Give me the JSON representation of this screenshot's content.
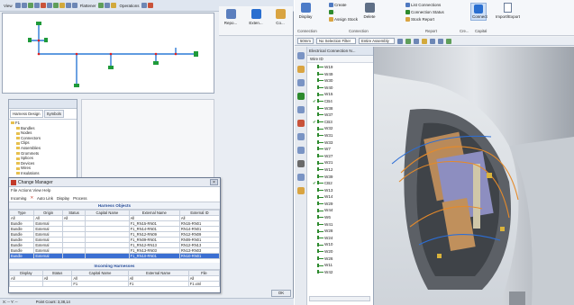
{
  "left_toolbar": {
    "view_label": "View",
    "flattener_label": "Flattener",
    "operations_label": "Operations"
  },
  "left_ribbon": {
    "items": [
      "Repo...",
      "Exten...",
      "Co..."
    ]
  },
  "design_window": {
    "tabs": [
      "Harness Design",
      "Symbols"
    ],
    "root": "F1",
    "tree_items": [
      "Bundles",
      "Nodes",
      "Connectors",
      "Clips",
      "Assemblies",
      "Grommets",
      "Splices",
      "Devices",
      "Wires",
      "Insulations"
    ]
  },
  "change_manager": {
    "title": "Change Manager",
    "menu": "File  Actions  View  Help",
    "toolbar": [
      "Incoming",
      "Auto Link",
      "Display",
      "Process"
    ],
    "harness_section": "Harness Objects",
    "harness_columns": [
      "Type",
      "Origin",
      "Status",
      "Capital Name",
      "External Name",
      "External ID"
    ],
    "harness_filter": [
      "All",
      "All",
      "All",
      "",
      "All",
      "All"
    ],
    "harness_rows": [
      [
        "Bundle",
        "External",
        "",
        "",
        "F1_RN15-RN01",
        "RN15-RN01"
      ],
      [
        "Bundle",
        "External",
        "",
        "",
        "F1_RN14-RN01",
        "RN14-RN01"
      ],
      [
        "Bundle",
        "External",
        "",
        "",
        "F1_RN12-RN09",
        "RN12-RN09"
      ],
      [
        "Bundle",
        "External",
        "",
        "",
        "F1_RN09-RN01",
        "RN09-RN01"
      ],
      [
        "Bundle",
        "External",
        "",
        "",
        "F1_RN12-RN13",
        "RN12-RN13"
      ],
      [
        "Bundle",
        "External",
        "",
        "",
        "F1_RN13-RN03",
        "RN13-RN03"
      ],
      [
        "Bundle",
        "External",
        "",
        "",
        "F1_RN10-RN01",
        "RN10-RN01"
      ]
    ],
    "selected_row": 6,
    "incoming_section": "Incoming Harnesses",
    "incoming_columns": [
      "Display",
      "Status",
      "Capital Name",
      "External Name",
      "File"
    ],
    "incoming_filter": [
      "All",
      "All",
      "All",
      "All",
      "All"
    ],
    "incoming_rows": [
      [
        "",
        "",
        "F1",
        "F1",
        "F1.xml"
      ]
    ],
    "ok_label": "OK"
  },
  "status_left": {
    "coords": "X: -- Y: --",
    "msg": "Point Count: 3,38,14"
  },
  "ribbon": {
    "display_label": "Display",
    "create_label": "Create",
    "delete_label": "Delete",
    "assign_stock_label": "Assign Stock",
    "list_connections_label": "List Connections",
    "connection_status_label": "Connection Status",
    "stock_report_label": "Stock Report",
    "connect_label": "Connect",
    "import_export_label": "Import/Export",
    "groups": [
      "Connection",
      "Connection",
      "Report",
      "Cre...",
      "Capital"
    ]
  },
  "option_bar": {
    "unit": "50mm",
    "filter": "No Selection Filter",
    "assembly": "Entire Assembly"
  },
  "ecob": {
    "title": "Electrical Connection N...",
    "column": "Wire ID",
    "wires": [
      {
        "id": "W19",
        "check": false
      },
      {
        "id": "W49",
        "check": false
      },
      {
        "id": "W30",
        "check": false
      },
      {
        "id": "W40",
        "check": false
      },
      {
        "id": "W15",
        "check": false
      },
      {
        "id": "CB4",
        "check": true,
        "group": true
      },
      {
        "id": "W38",
        "check": false
      },
      {
        "id": "W37",
        "check": false
      },
      {
        "id": "CB3",
        "check": true,
        "group": true
      },
      {
        "id": "W32",
        "check": false
      },
      {
        "id": "W31",
        "check": false
      },
      {
        "id": "W33",
        "check": false
      },
      {
        "id": "W7",
        "check": false
      },
      {
        "id": "W27",
        "check": false
      },
      {
        "id": "W21",
        "check": false
      },
      {
        "id": "W12",
        "check": false
      },
      {
        "id": "W39",
        "check": false
      },
      {
        "id": "CB2",
        "check": true,
        "group": true
      },
      {
        "id": "W13",
        "check": false
      },
      {
        "id": "W14",
        "check": false
      },
      {
        "id": "W29",
        "check": false
      },
      {
        "id": "W44",
        "check": false
      },
      {
        "id": "W6",
        "check": false
      },
      {
        "id": "W41",
        "check": false
      },
      {
        "id": "W28",
        "check": false
      },
      {
        "id": "W24",
        "check": false
      },
      {
        "id": "W10",
        "check": false
      },
      {
        "id": "W20",
        "check": false
      },
      {
        "id": "W26",
        "check": false
      },
      {
        "id": "W11",
        "check": false
      },
      {
        "id": "W42",
        "check": false
      }
    ]
  },
  "colors": {
    "accent": "#3b6fd2",
    "wire_green": "#2d8a2d",
    "harness_blue": "#2a4f9a"
  }
}
